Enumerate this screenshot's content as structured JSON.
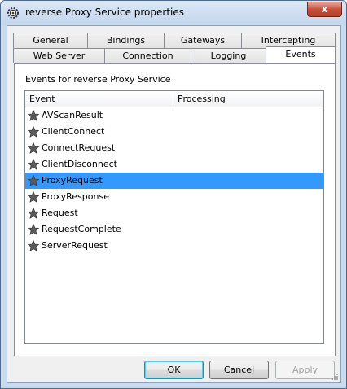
{
  "window": {
    "title": "reverse Proxy Service properties",
    "close_glyph": "x"
  },
  "tabs": {
    "row_back": [
      "General",
      "Bindings",
      "Gateways",
      "Intercepting"
    ],
    "row_front": [
      "Web Server",
      "Connection",
      "Logging",
      "Events"
    ],
    "active": "Events"
  },
  "panel": {
    "label": "Events for reverse Proxy Service",
    "columns": [
      "Event",
      "Processing"
    ],
    "events": [
      "AVScanResult",
      "ClientConnect",
      "ConnectRequest",
      "ClientDisconnect",
      "ProxyRequest",
      "ProxyResponse",
      "Request",
      "RequestComplete",
      "ServerRequest"
    ],
    "selected_event": "ProxyRequest"
  },
  "buttons": {
    "ok": "OK",
    "cancel": "Cancel",
    "apply": "Apply"
  },
  "colors": {
    "selection": "#3399ff",
    "titlebar": "#c8daec"
  },
  "icons": {
    "app": "gear-icon",
    "event": "star-icon"
  }
}
